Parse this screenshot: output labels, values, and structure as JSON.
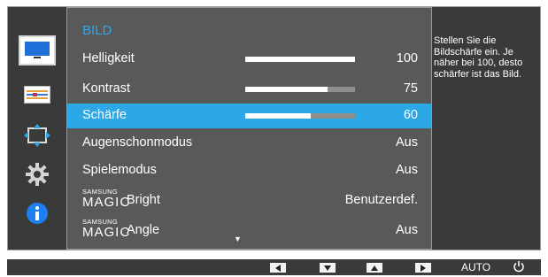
{
  "menu": {
    "title": "BILD",
    "rows": [
      {
        "label": "Helligkeit",
        "value": "100",
        "bar": 1.0
      },
      {
        "label": "Kontrast",
        "value": "75",
        "bar": 0.75
      },
      {
        "label": "Schärfe",
        "value": "60",
        "bar": 0.6,
        "selected": true
      },
      {
        "label": "Augenschonmodus",
        "value": "Aus"
      },
      {
        "label": "Spielemodus",
        "value": "Aus"
      },
      {
        "brand": "SAMSUNG",
        "magic": "MAGIC",
        "label": "Bright",
        "value": "Benutzerdef."
      },
      {
        "brand": "SAMSUNG",
        "magic": "MAGIC",
        "label": "Angle",
        "value": "Aus"
      }
    ],
    "scroll_arrow": "▼"
  },
  "help_text": "Stellen Sie die Bildschärfe ein. Je näher bei 100, desto schärfer ist das Bild.",
  "footer": {
    "auto_label": "AUTO"
  },
  "icons": [
    "picture-icon",
    "onscreen-display-icon",
    "position-icon",
    "settings-gear-icon",
    "information-icon"
  ],
  "colors": {
    "accent": "#2ca8e7",
    "title": "#2fa8e8"
  }
}
